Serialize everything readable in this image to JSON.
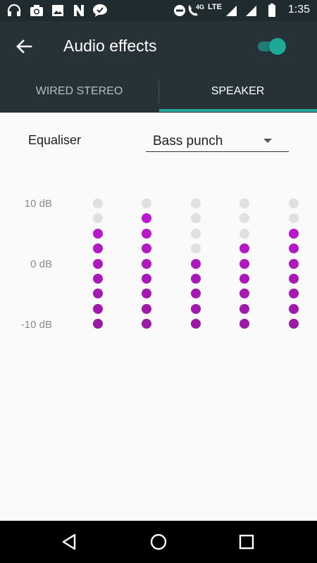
{
  "status_bar": {
    "time": "1:35",
    "network_4g": "4G",
    "network_lte": "LTE",
    "icons": [
      "headphones-icon",
      "camera-icon",
      "image-icon",
      "n-app-icon",
      "chat-icon",
      "do-not-disturb-icon",
      "wifi-calling-icon",
      "signal-icon",
      "signal-icon",
      "battery-icon"
    ]
  },
  "toolbar": {
    "title": "Audio effects",
    "back_icon": "arrow-back-icon",
    "switch_on": true
  },
  "tabs": [
    {
      "label": "WIRED STEREO",
      "selected": false
    },
    {
      "label": "SPEAKER",
      "selected": true
    }
  ],
  "equaliser": {
    "label": "Equaliser",
    "preset": "Bass punch",
    "db_labels": [
      "10 dB",
      "0 dB",
      "-10 dB"
    ],
    "levels_per_band": 9,
    "active_levels": [
      7,
      8,
      5,
      6,
      7
    ]
  },
  "nav_bar": {
    "icons": [
      "back-triangle-icon",
      "home-circle-icon",
      "recents-square-icon"
    ]
  },
  "colors": {
    "toolbar": "#263238",
    "accent": "#26a69a",
    "dot_inactive": "#e0e0e0",
    "dot_active_top": "#c116d8",
    "dot_active_bottom": "#9a1ba3"
  }
}
